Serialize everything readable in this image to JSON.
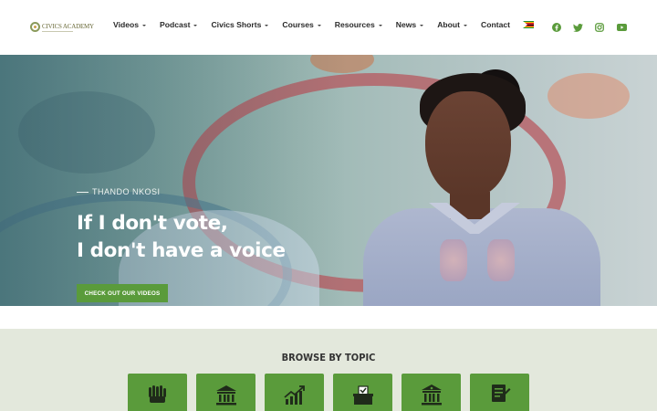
{
  "logo": {
    "text": "CIVICS ACADEMY"
  },
  "nav": {
    "items": [
      {
        "label": "Videos",
        "dropdown": true
      },
      {
        "label": "Podcast",
        "dropdown": true
      },
      {
        "label": "Civics Shorts",
        "dropdown": true
      },
      {
        "label": "Courses",
        "dropdown": true
      },
      {
        "label": "Resources",
        "dropdown": true
      },
      {
        "label": "News",
        "dropdown": true
      },
      {
        "label": "About",
        "dropdown": true
      },
      {
        "label": "Contact",
        "dropdown": false
      }
    ],
    "language_flag": "zimbabwe-flag-icon"
  },
  "social": [
    "facebook-icon",
    "twitter-icon",
    "instagram-icon",
    "youtube-icon"
  ],
  "hero": {
    "subtitle": "THANDO NKOSI",
    "headline_line1": "If I don't vote,",
    "headline_line2": "I don't have a voice",
    "cta_label": "CHECK OUT OUR VIDEOS"
  },
  "browse": {
    "title": "BROWSE BY TOPIC",
    "tiles": [
      {
        "icon": "raised-hands-icon"
      },
      {
        "icon": "government-building-icon"
      },
      {
        "icon": "growth-chart-icon"
      },
      {
        "icon": "ballot-box-icon"
      },
      {
        "icon": "courthouse-icon"
      },
      {
        "icon": "constitution-document-icon"
      }
    ]
  },
  "colors": {
    "accent": "#5a9b3b",
    "browse_bg": "#e3e8dc",
    "text_dark": "#2b2b2b"
  }
}
